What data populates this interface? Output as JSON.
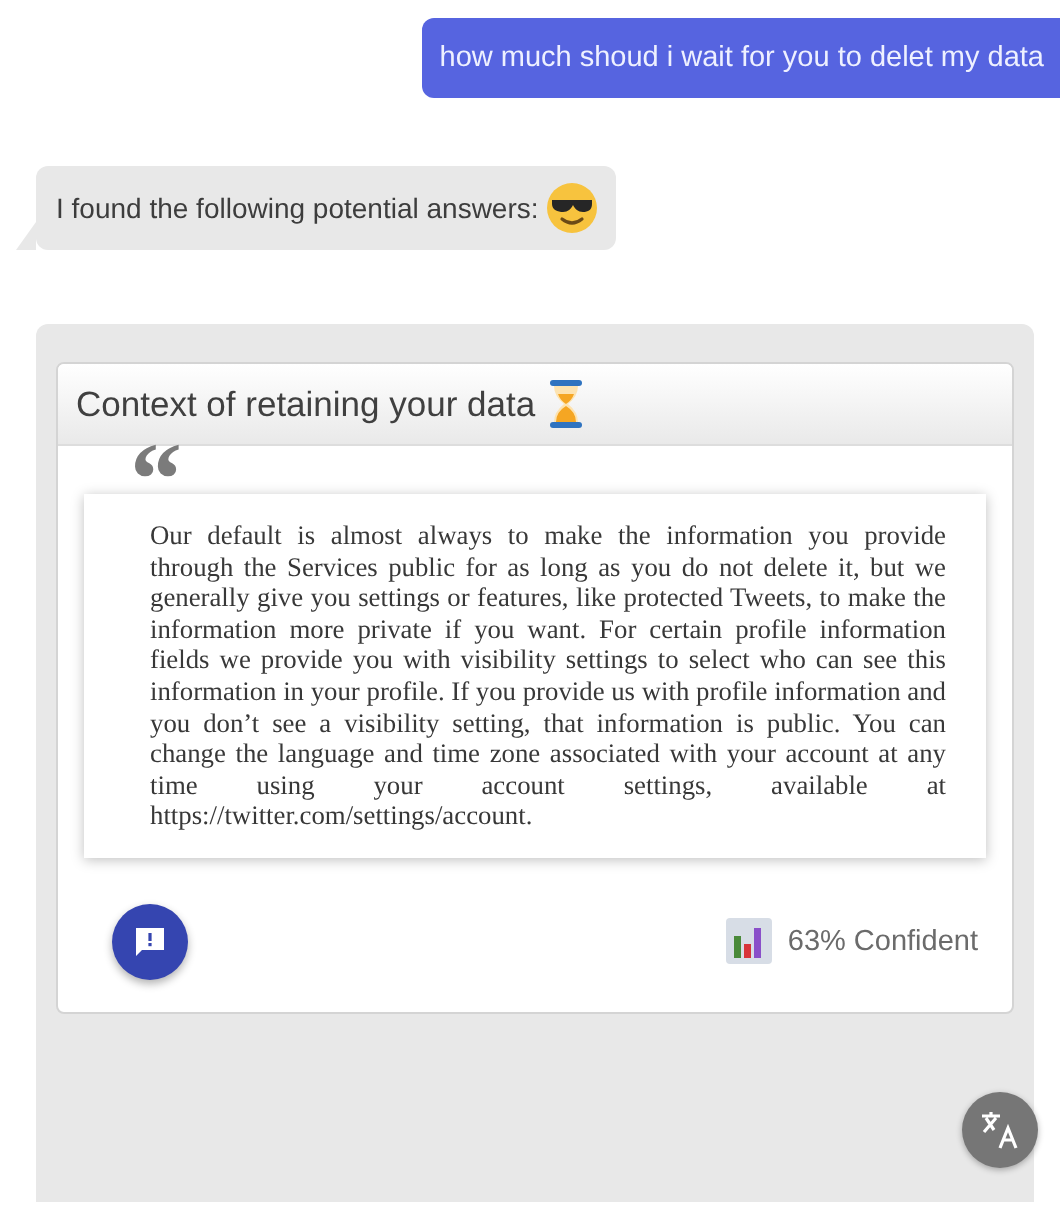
{
  "messages": [
    {
      "kind": "user",
      "text": "how much shoud i wait for you to delet my data"
    },
    {
      "kind": "bot",
      "text": "I found the following potential answers:"
    }
  ],
  "answer": {
    "title": "Context of retaining your data",
    "quote_mark": "“",
    "body": "Our default is almost always to make the information you provide through the Services public for as long as you do not delete it, but we generally give you settings or features, like protected Tweets, to make the information more private if you want. For certain profile information fields we provide you with visibility settings to select who can see this information in your profile. If you provide us with profile information and you don’t see a visibility setting, that information is public. You can change the language and time zone associated with your account at any time using your account settings, available at https://twitter.com/settings/account.",
    "confidence": "63% Confident"
  }
}
